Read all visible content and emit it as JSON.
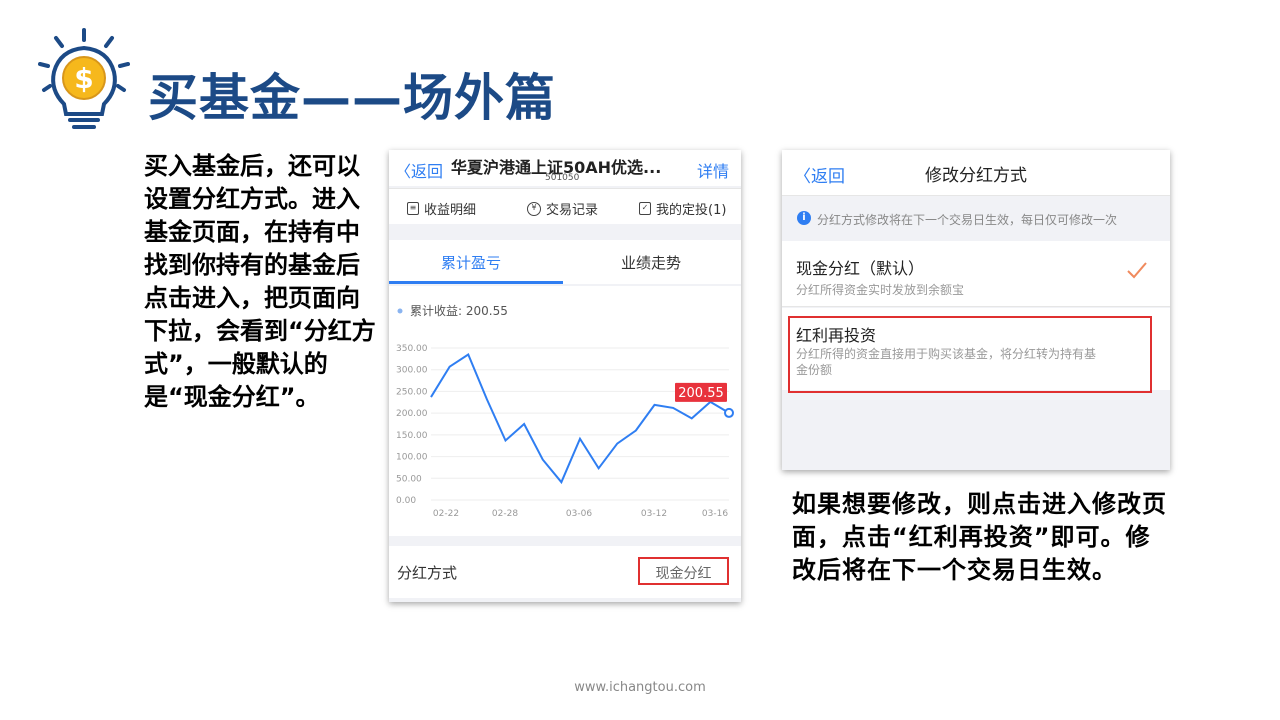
{
  "title": "买基金——场外篇",
  "left_paragraph": "买入基金后，还可以设置分红方式。进入基金页面，在持有中找到你持有的基金后点击进入，把页面向下拉，会看到“分红方式”，一般默认的是“现金分红”。",
  "right_paragraph": "如果想要修改，则点击进入修改页面，点击“红利再投资”即可。修改后将在下一个交易日生效。",
  "footer": "www.ichangtou.com",
  "phone1": {
    "back": "〈返回",
    "fund_name": "华夏沪港通上证50AH优选...",
    "fund_code": "501050",
    "detail": "详情",
    "menu": [
      "收益明细",
      "交易记录",
      "我的定投(1)"
    ],
    "tabs": [
      "累计盈亏",
      "业绩走势"
    ],
    "legend": "累计收益: 200.55",
    "dividend_label": "分红方式",
    "dividend_value": "现金分红"
  },
  "chart_data": {
    "type": "line",
    "title": "",
    "xlabel": "",
    "ylabel": "",
    "series": [
      {
        "name": "累计收益",
        "values": [
          237,
          307,
          335,
          232,
          137,
          175,
          93,
          41,
          141,
          73,
          130,
          160,
          219,
          212,
          188,
          226,
          200.55
        ]
      }
    ],
    "x_ticks": [
      "02-22",
      "02-28",
      "03-06",
      "03-12",
      "03-16"
    ],
    "y_ticks": [
      "350.00",
      "300.00",
      "250.00",
      "200.00",
      "150.00",
      "100.00",
      "50.00",
      "0.00"
    ],
    "ylim": [
      0,
      350
    ],
    "last_value_label": "200.55",
    "line_color": "#2f7ef2",
    "label_color": "#e8323c"
  },
  "phone2": {
    "back": "〈返回",
    "title": "修改分红方式",
    "notice": "分红方式修改将在下一个交易日生效，每日仅可修改一次",
    "option1_title": "现金分红（默认）",
    "option1_sub": "分红所得资金实时发放到余额宝",
    "option2_title": "红利再投资",
    "option2_sub": "分红所得的资金直接用于购买该基金，将分红转为持有基金份额"
  }
}
